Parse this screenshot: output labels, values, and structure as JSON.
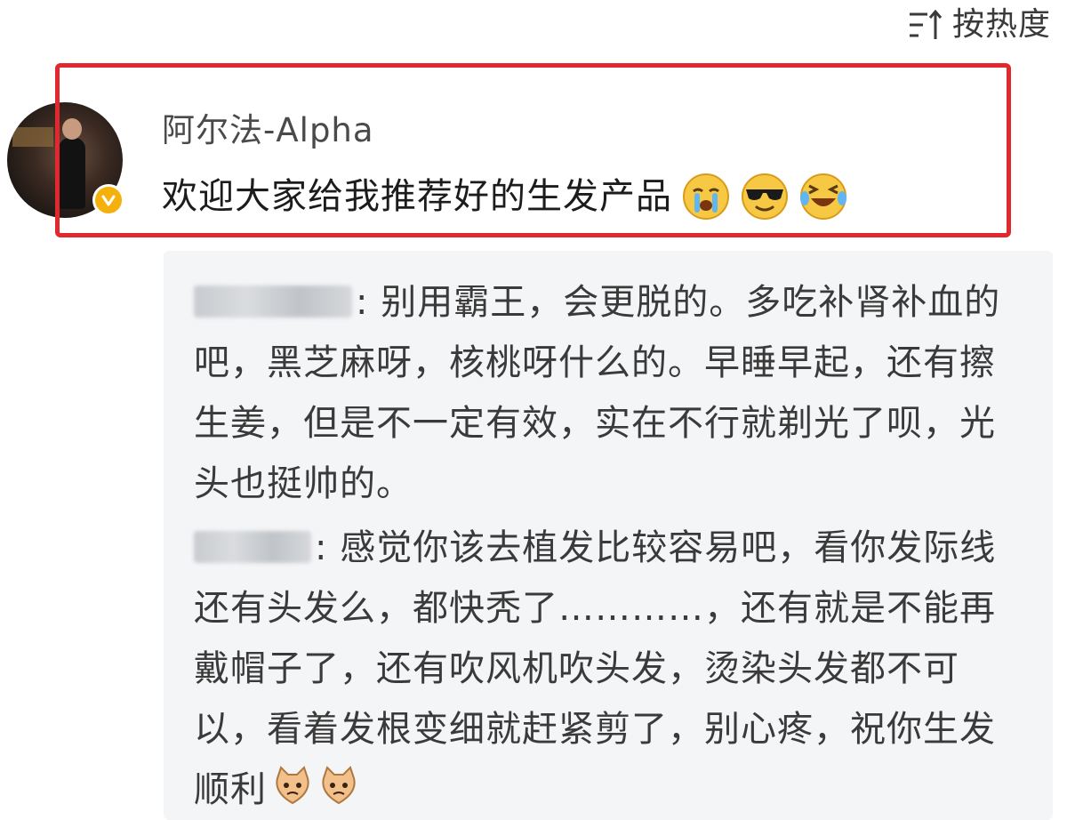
{
  "sort": {
    "label": "按热度",
    "icon": "sort-icon"
  },
  "comment": {
    "username": "阿尔法-Alpha",
    "text": "欢迎大家给我推荐好的生发产品",
    "verified": true,
    "emojis": [
      "crying-emoji",
      "sunglasses-emoji",
      "laughing-tears-emoji"
    ]
  },
  "replies": [
    {
      "text": ": 别用霸王，会更脱的。多吃补肾补血的吧，黑芝麻呀，核桃呀什么的。早睡早起，还有擦生姜，但是不一定有效，实在不行就剃光了呗，光头也挺帅的。"
    },
    {
      "text": ": 感觉你该去植发比较容易吧，看你发际线还有头发么，都快秃了…………，还有就是不能再戴帽子了，还有吹风机吹头发，烫染头发都不可以，看着发根变细就赶紧剪了，别心疼，祝你生发顺利",
      "emojis": [
        "cat-emoji",
        "cat-emoji"
      ]
    }
  ],
  "colors": {
    "highlight_border": "#e0282e",
    "verified_badge": "#f5b10b",
    "reply_background": "#f4f5f7"
  }
}
